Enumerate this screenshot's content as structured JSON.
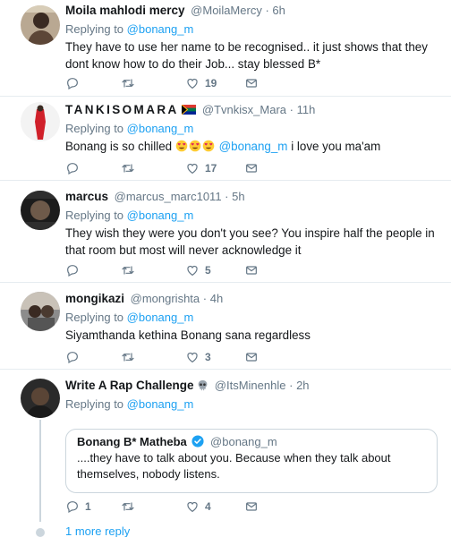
{
  "tweets": [
    {
      "name": "Moila mahlodi mercy",
      "handle": "@MoilaMercy",
      "time": "6h",
      "replying_label": "Replying to",
      "replying_to": "@bonang_m",
      "text": "They have to use her name to be recognised.. it just shows that they dont know how to do their Job... stay blessed B*",
      "replies": "",
      "retweets": "",
      "likes": "19"
    },
    {
      "name": "TANKISOMARA",
      "handle": "@Tvnkisx_Mara",
      "time": "11h",
      "replying_label": "Replying to",
      "replying_to": "@bonang_m",
      "text_before": "Bonang is so chilled",
      "text_mention": "@bonang_m",
      "text_after": "i love you ma'am",
      "replies": "",
      "retweets": "",
      "likes": "17"
    },
    {
      "name": "marcus",
      "handle": "@marcus_marc1011",
      "time": "5h",
      "replying_label": "Replying to",
      "replying_to": "@bonang_m",
      "text": "They wish they were you don't you see? You inspire half the people in that room but most will never acknowledge it",
      "replies": "",
      "retweets": "",
      "likes": "5"
    },
    {
      "name": "mongikazi",
      "handle": "@mongrishta",
      "time": "4h",
      "replying_label": "Replying to",
      "replying_to": "@bonang_m",
      "text": "Siyamthanda kethina Bonang sana regardless",
      "replies": "",
      "retweets": "",
      "likes": "3"
    },
    {
      "name": "Write A Rap Challenge",
      "handle": "@ItsMinenhle",
      "time": "2h",
      "replying_label": "Replying to",
      "replying_to": "@bonang_m",
      "quote": {
        "name": "Bonang B* Matheba",
        "handle": "@bonang_m",
        "text": "....they have to talk about you. Because when they talk about themselves, nobody listens."
      },
      "replies": "1",
      "retweets": "",
      "likes": "4"
    }
  ],
  "more_replies": "1 more reply",
  "separator": "·",
  "icons": {
    "reply": "reply-icon",
    "retweet": "retweet-icon",
    "like": "heart-icon",
    "dm": "envelope-icon",
    "flag": "south-africa-flag-icon",
    "skull": "skull-icon",
    "heart_eyes": "heart-eyes-emoji-icon",
    "verified": "verified-badge-icon"
  },
  "colors": {
    "link": "#1da1f2",
    "muted": "#657786",
    "border": "#e6ecf0"
  }
}
